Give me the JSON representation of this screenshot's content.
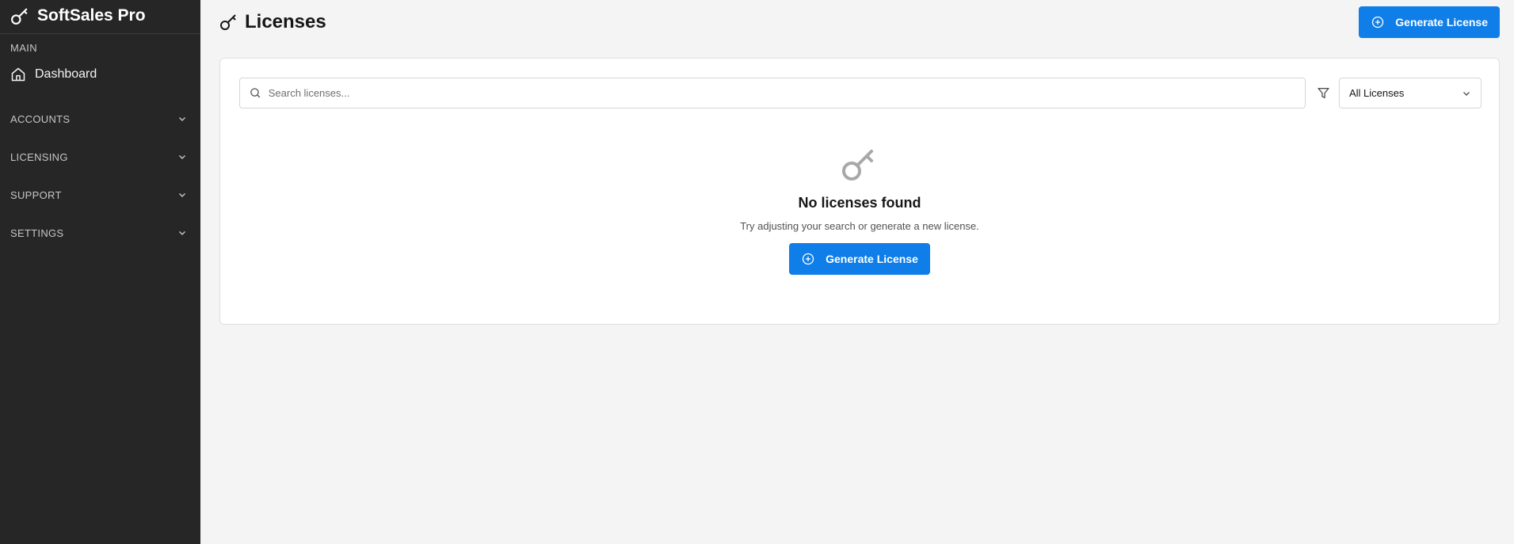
{
  "sidebar": {
    "brand": "SoftSales Pro",
    "section_main": "MAIN",
    "dashboard": "Dashboard",
    "groups": [
      {
        "label": "ACCOUNTS"
      },
      {
        "label": "LICENSING"
      },
      {
        "label": "SUPPORT"
      },
      {
        "label": "SETTINGS"
      }
    ]
  },
  "header": {
    "title": "Licenses",
    "generate_button": "Generate License"
  },
  "search": {
    "placeholder": "Search licenses...",
    "value": ""
  },
  "filter": {
    "selected": "All Licenses"
  },
  "empty_state": {
    "title": "No licenses found",
    "message": "Try adjusting your search or generate a new license.",
    "button": "Generate License"
  },
  "colors": {
    "accent": "#0f7ee8",
    "sidebar_bg": "#262626",
    "page_bg": "#f4f4f4"
  },
  "icons": {
    "brand": "key-icon",
    "dashboard": "home-icon",
    "search": "search-icon",
    "filter": "filter-icon",
    "add": "add-circle-icon",
    "empty": "key-icon"
  }
}
